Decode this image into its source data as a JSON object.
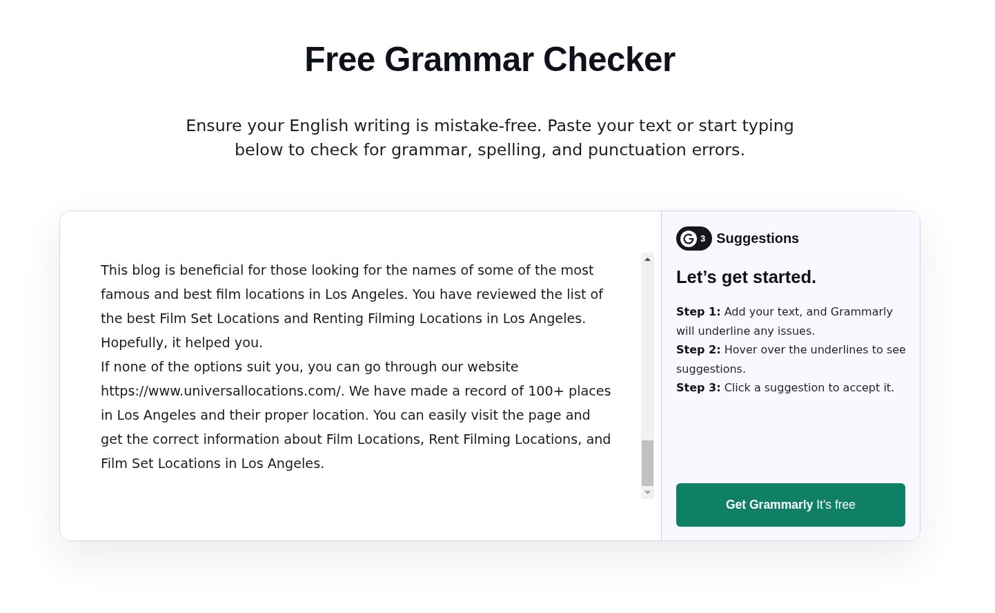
{
  "header": {
    "title": "Free Grammar Checker",
    "subtitle": "Ensure your English writing is mistake-free. Paste your text or start typing below to check for grammar, spelling, and punctuation errors."
  },
  "editor": {
    "paragraphs": [
      "This blog is beneficial for those looking for the names of some of the most famous and best film locations in Los Angeles. You have reviewed the list of the best Film Set Locations and Renting Filming Locations in Los Angeles. Hopefully, it helped you.",
      "If none of the options suit you, you can go through our website https://www.universallocations.com/. We have made a record of 100+ places in Los Angeles and their proper location. You can easily visit the page and get the correct information about Film Locations, Rent Filming Locations, and Film Set Locations in Los Angeles."
    ]
  },
  "suggestions_panel": {
    "count": "3",
    "label": "Suggestions",
    "heading": "Let’s get started.",
    "steps": [
      "**Step 1:** Add your text, and Grammarly will underline any issues.",
      "**Step 2:** Hover over the underlines to see suggestions.",
      "**Step 3:** Click a suggestion to accept it."
    ],
    "button": "**Get Grammarly** It's free"
  }
}
